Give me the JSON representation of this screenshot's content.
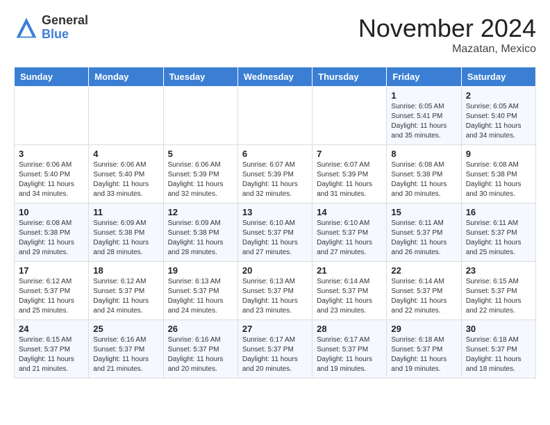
{
  "header": {
    "logo_general": "General",
    "logo_blue": "Blue",
    "month_title": "November 2024",
    "location": "Mazatan, Mexico"
  },
  "weekdays": [
    "Sunday",
    "Monday",
    "Tuesday",
    "Wednesday",
    "Thursday",
    "Friday",
    "Saturday"
  ],
  "weeks": [
    [
      {
        "day": "",
        "info": ""
      },
      {
        "day": "",
        "info": ""
      },
      {
        "day": "",
        "info": ""
      },
      {
        "day": "",
        "info": ""
      },
      {
        "day": "",
        "info": ""
      },
      {
        "day": "1",
        "info": "Sunrise: 6:05 AM\nSunset: 5:41 PM\nDaylight: 11 hours\nand 35 minutes."
      },
      {
        "day": "2",
        "info": "Sunrise: 6:05 AM\nSunset: 5:40 PM\nDaylight: 11 hours\nand 34 minutes."
      }
    ],
    [
      {
        "day": "3",
        "info": "Sunrise: 6:06 AM\nSunset: 5:40 PM\nDaylight: 11 hours\nand 34 minutes."
      },
      {
        "day": "4",
        "info": "Sunrise: 6:06 AM\nSunset: 5:40 PM\nDaylight: 11 hours\nand 33 minutes."
      },
      {
        "day": "5",
        "info": "Sunrise: 6:06 AM\nSunset: 5:39 PM\nDaylight: 11 hours\nand 32 minutes."
      },
      {
        "day": "6",
        "info": "Sunrise: 6:07 AM\nSunset: 5:39 PM\nDaylight: 11 hours\nand 32 minutes."
      },
      {
        "day": "7",
        "info": "Sunrise: 6:07 AM\nSunset: 5:39 PM\nDaylight: 11 hours\nand 31 minutes."
      },
      {
        "day": "8",
        "info": "Sunrise: 6:08 AM\nSunset: 5:38 PM\nDaylight: 11 hours\nand 30 minutes."
      },
      {
        "day": "9",
        "info": "Sunrise: 6:08 AM\nSunset: 5:38 PM\nDaylight: 11 hours\nand 30 minutes."
      }
    ],
    [
      {
        "day": "10",
        "info": "Sunrise: 6:08 AM\nSunset: 5:38 PM\nDaylight: 11 hours\nand 29 minutes."
      },
      {
        "day": "11",
        "info": "Sunrise: 6:09 AM\nSunset: 5:38 PM\nDaylight: 11 hours\nand 28 minutes."
      },
      {
        "day": "12",
        "info": "Sunrise: 6:09 AM\nSunset: 5:38 PM\nDaylight: 11 hours\nand 28 minutes."
      },
      {
        "day": "13",
        "info": "Sunrise: 6:10 AM\nSunset: 5:37 PM\nDaylight: 11 hours\nand 27 minutes."
      },
      {
        "day": "14",
        "info": "Sunrise: 6:10 AM\nSunset: 5:37 PM\nDaylight: 11 hours\nand 27 minutes."
      },
      {
        "day": "15",
        "info": "Sunrise: 6:11 AM\nSunset: 5:37 PM\nDaylight: 11 hours\nand 26 minutes."
      },
      {
        "day": "16",
        "info": "Sunrise: 6:11 AM\nSunset: 5:37 PM\nDaylight: 11 hours\nand 25 minutes."
      }
    ],
    [
      {
        "day": "17",
        "info": "Sunrise: 6:12 AM\nSunset: 5:37 PM\nDaylight: 11 hours\nand 25 minutes."
      },
      {
        "day": "18",
        "info": "Sunrise: 6:12 AM\nSunset: 5:37 PM\nDaylight: 11 hours\nand 24 minutes."
      },
      {
        "day": "19",
        "info": "Sunrise: 6:13 AM\nSunset: 5:37 PM\nDaylight: 11 hours\nand 24 minutes."
      },
      {
        "day": "20",
        "info": "Sunrise: 6:13 AM\nSunset: 5:37 PM\nDaylight: 11 hours\nand 23 minutes."
      },
      {
        "day": "21",
        "info": "Sunrise: 6:14 AM\nSunset: 5:37 PM\nDaylight: 11 hours\nand 23 minutes."
      },
      {
        "day": "22",
        "info": "Sunrise: 6:14 AM\nSunset: 5:37 PM\nDaylight: 11 hours\nand 22 minutes."
      },
      {
        "day": "23",
        "info": "Sunrise: 6:15 AM\nSunset: 5:37 PM\nDaylight: 11 hours\nand 22 minutes."
      }
    ],
    [
      {
        "day": "24",
        "info": "Sunrise: 6:15 AM\nSunset: 5:37 PM\nDaylight: 11 hours\nand 21 minutes."
      },
      {
        "day": "25",
        "info": "Sunrise: 6:16 AM\nSunset: 5:37 PM\nDaylight: 11 hours\nand 21 minutes."
      },
      {
        "day": "26",
        "info": "Sunrise: 6:16 AM\nSunset: 5:37 PM\nDaylight: 11 hours\nand 20 minutes."
      },
      {
        "day": "27",
        "info": "Sunrise: 6:17 AM\nSunset: 5:37 PM\nDaylight: 11 hours\nand 20 minutes."
      },
      {
        "day": "28",
        "info": "Sunrise: 6:17 AM\nSunset: 5:37 PM\nDaylight: 11 hours\nand 19 minutes."
      },
      {
        "day": "29",
        "info": "Sunrise: 6:18 AM\nSunset: 5:37 PM\nDaylight: 11 hours\nand 19 minutes."
      },
      {
        "day": "30",
        "info": "Sunrise: 6:18 AM\nSunset: 5:37 PM\nDaylight: 11 hours\nand 18 minutes."
      }
    ]
  ]
}
